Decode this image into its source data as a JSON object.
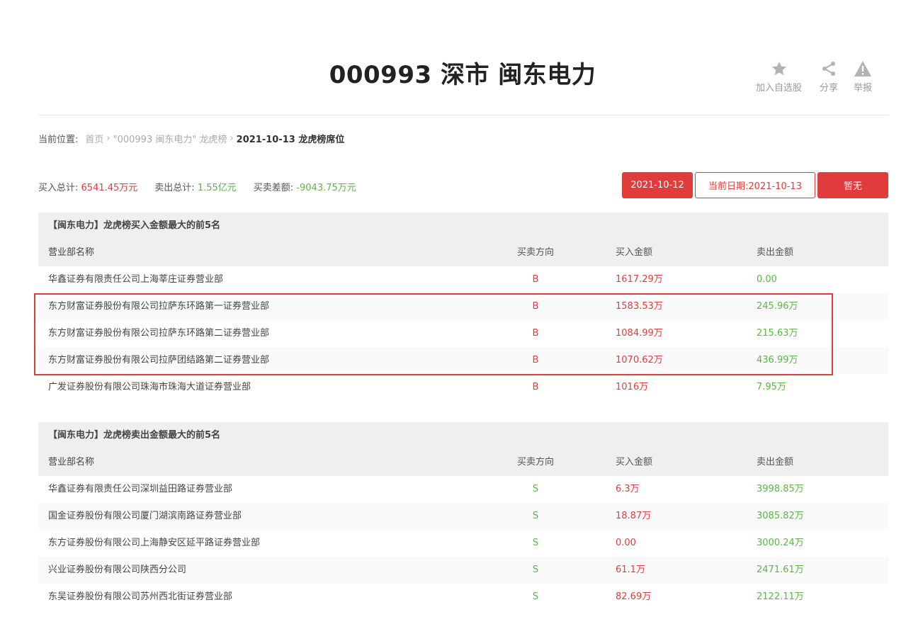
{
  "page_title": "000993 深市 闽东电力",
  "actions": [
    {
      "label": "加入自选股",
      "icon": "star-icon"
    },
    {
      "label": "分享",
      "icon": "share-icon"
    },
    {
      "label": "举报",
      "icon": "warning-icon"
    }
  ],
  "breadcrumb": {
    "prefix": "当前位置:",
    "home": "首页",
    "sep": "›",
    "parent": "\"000993 闽东电力\" 龙虎榜",
    "current": "2021-10-13 龙虎榜席位"
  },
  "summary": {
    "buy_label": "买入总计:",
    "buy_value": "6541.45万元",
    "sell_label": "卖出总计:",
    "sell_value": "1.55亿元",
    "diff_label": "买卖差额:",
    "diff_value": "-9043.75万元"
  },
  "dates": {
    "prev": "2021-10-12",
    "current": "当前日期:2021-10-13",
    "next": "暂无"
  },
  "colors": {
    "accent_red": "#e03c3c",
    "green": "#5ab645"
  },
  "buy_table": {
    "title": "【闽东电力】龙虎榜买入金额最大的前5名",
    "headers": [
      "营业部名称",
      "买卖方向",
      "买入金额",
      "卖出金额"
    ],
    "rows": [
      {
        "name": "华鑫证券有限责任公司上海莘庄证券营业部",
        "dir": "B",
        "buy": "1617.29万",
        "sell": "0.00"
      },
      {
        "name": "东方财富证券股份有限公司拉萨东环路第一证券营业部",
        "dir": "B",
        "buy": "1583.53万",
        "sell": "245.96万"
      },
      {
        "name": "东方财富证券股份有限公司拉萨东环路第二证券营业部",
        "dir": "B",
        "buy": "1084.99万",
        "sell": "215.63万"
      },
      {
        "name": "东方财富证券股份有限公司拉萨团结路第二证券营业部",
        "dir": "B",
        "buy": "1070.62万",
        "sell": "436.99万"
      },
      {
        "name": "广发证券股份有限公司珠海市珠海大道证券营业部",
        "dir": "B",
        "buy": "1016万",
        "sell": "7.95万"
      }
    ]
  },
  "sell_table": {
    "title": "【闽东电力】龙虎榜卖出金额最大的前5名",
    "headers": [
      "营业部名称",
      "买卖方向",
      "买入金额",
      "卖出金额"
    ],
    "rows": [
      {
        "name": "华鑫证券有限责任公司深圳益田路证券营业部",
        "dir": "S",
        "buy": "6.3万",
        "sell": "3998.85万"
      },
      {
        "name": "国金证券股份有限公司厦门湖滨南路证券营业部",
        "dir": "S",
        "buy": "18.87万",
        "sell": "3085.82万"
      },
      {
        "name": "东方证券股份有限公司上海静安区延平路证券营业部",
        "dir": "S",
        "buy": "0.00",
        "sell": "3000.24万"
      },
      {
        "name": "兴业证券股份有限公司陕西分公司",
        "dir": "S",
        "buy": "61.1万",
        "sell": "2471.61万"
      },
      {
        "name": "东吴证券股份有限公司苏州西北街证券营业部",
        "dir": "S",
        "buy": "82.69万",
        "sell": "2122.11万"
      }
    ]
  }
}
